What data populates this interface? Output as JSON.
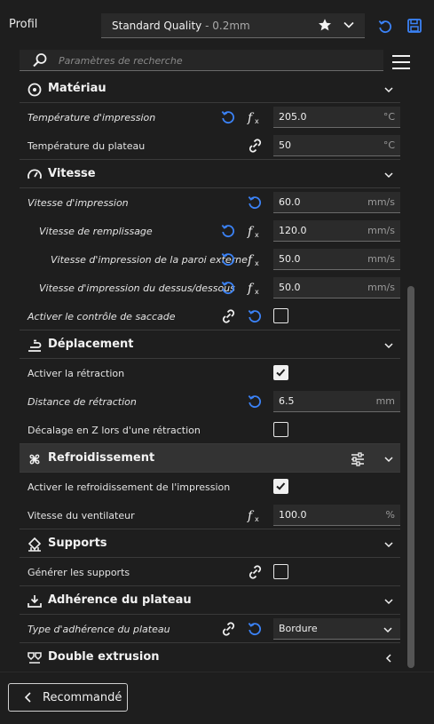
{
  "header": {
    "profil_label": "Profil",
    "profile_name": "Standard Quality",
    "profile_separator": " - ",
    "profile_layer": "0.2mm"
  },
  "search": {
    "placeholder": "Paramètres de recherche",
    "value": ""
  },
  "sections": {
    "materiau": {
      "title": "Matériau"
    },
    "vitesse": {
      "title": "Vitesse"
    },
    "deplacement": {
      "title": "Déplacement"
    },
    "refroidissement": {
      "title": "Refroidissement"
    },
    "supports": {
      "title": "Supports"
    },
    "adherence": {
      "title": "Adhérence du plateau"
    },
    "double_extrusion": {
      "title": "Double extrusion"
    }
  },
  "rows": {
    "temp_impression": {
      "label": "Température d'impression",
      "value": "205.0",
      "unit": "°C"
    },
    "temp_plateau": {
      "label": "Température du plateau",
      "value": "50",
      "unit": "°C"
    },
    "vitesse_impression": {
      "label": "Vitesse d'impression",
      "value": "60.0",
      "unit": "mm/s"
    },
    "vitesse_remplissage": {
      "label": "Vitesse de remplissage",
      "value": "120.0",
      "unit": "mm/s"
    },
    "vitesse_paroi_externe": {
      "label": "Vitesse d'impression de la paroi externe",
      "value": "50.0",
      "unit": "mm/s"
    },
    "vitesse_dessus_dessous": {
      "label": "Vitesse d'impression du dessus/dessous",
      "value": "50.0",
      "unit": "mm/s"
    },
    "controle_saccade": {
      "label": "Activer le contrôle de saccade",
      "checked": false
    },
    "activer_retraction": {
      "label": "Activer la rétraction",
      "checked": true
    },
    "distance_retraction": {
      "label": "Distance de rétraction",
      "value": "6.5",
      "unit": "mm"
    },
    "decalage_z": {
      "label": "Décalage en Z lors d'une rétraction",
      "checked": false
    },
    "activer_refroidissement": {
      "label": "Activer le refroidissement de l'impression",
      "checked": true
    },
    "vitesse_ventilateur": {
      "label": "Vitesse du ventilateur",
      "value": "100.0",
      "unit": "%"
    },
    "generer_supports": {
      "label": "Générer les supports",
      "checked": false
    },
    "type_adherence": {
      "label": "Type d'adhérence du plateau",
      "value": "Bordure"
    }
  },
  "footer": {
    "recommended_label": "Recommandé"
  },
  "colors": {
    "accent": "#3b82f6",
    "background": "#1e1e1e",
    "field": "#2b2b2b",
    "text": "#e8e8e8"
  }
}
